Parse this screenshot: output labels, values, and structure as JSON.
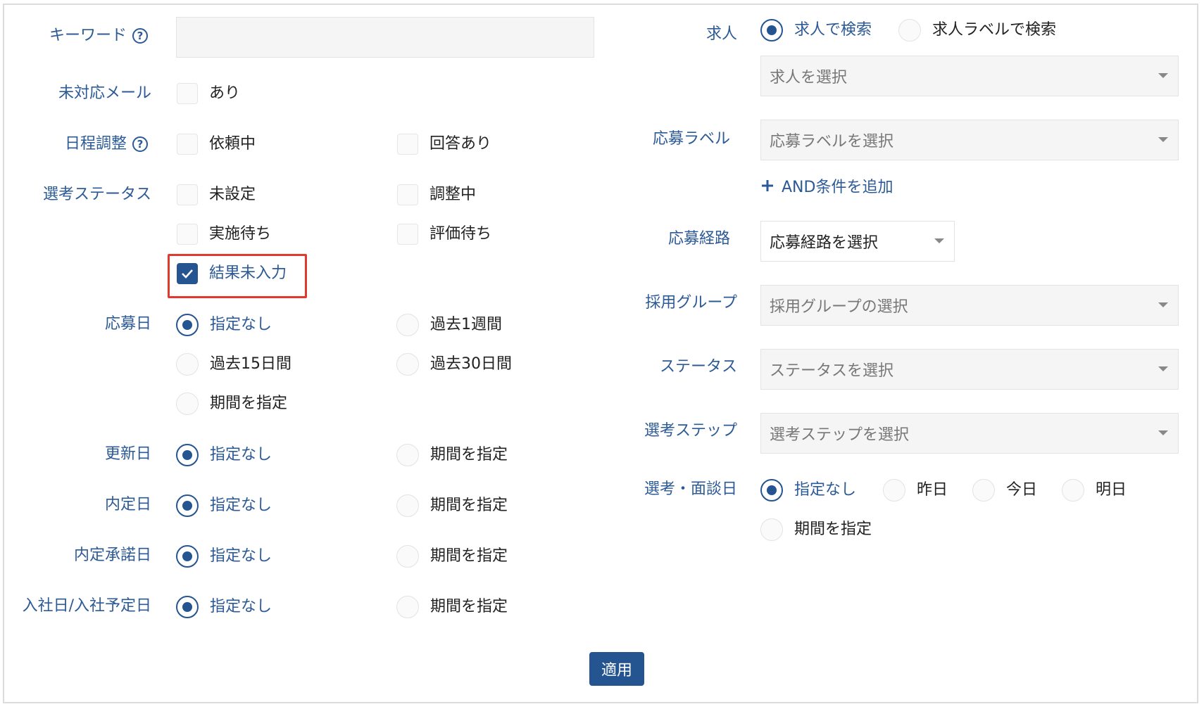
{
  "left": {
    "keyword_label": "キーワード",
    "keyword_value": "",
    "unhandled_mail": {
      "label": "未対応メール",
      "option": "あり"
    },
    "schedule": {
      "label": "日程調整",
      "options": [
        "依頼中",
        "回答あり"
      ]
    },
    "selection_status": {
      "label": "選考ステータス",
      "options": [
        "未設定",
        "調整中",
        "実施待ち",
        "評価待ち",
        "結果未入力"
      ],
      "checked": "結果未入力"
    },
    "applied_date": {
      "label": "応募日",
      "options": [
        "指定なし",
        "過去1週間",
        "過去15日間",
        "過去30日間",
        "期間を指定"
      ],
      "selected": "指定なし"
    },
    "updated_date": {
      "label": "更新日",
      "options": [
        "指定なし",
        "期間を指定"
      ],
      "selected": "指定なし"
    },
    "offer_date": {
      "label": "内定日",
      "options": [
        "指定なし",
        "期間を指定"
      ],
      "selected": "指定なし"
    },
    "offer_accept_date": {
      "label": "内定承諾日",
      "options": [
        "指定なし",
        "期間を指定"
      ],
      "selected": "指定なし"
    },
    "join_date": {
      "label": "入社日/入社予定日",
      "options": [
        "指定なし",
        "期間を指定"
      ],
      "selected": "指定なし"
    }
  },
  "right": {
    "job": {
      "label": "求人",
      "options": [
        "求人で検索",
        "求人ラベルで検索"
      ],
      "selected": "求人で検索",
      "placeholder": "求人を選択"
    },
    "apply_label": {
      "label": "応募ラベル",
      "placeholder": "応募ラベルを選択",
      "add_link": "AND条件を追加",
      "add_icon": "plus-icon"
    },
    "apply_route": {
      "label": "応募経路",
      "value": "応募経路を選択"
    },
    "hiring_group": {
      "label": "採用グループ",
      "placeholder": "採用グループの選択"
    },
    "status": {
      "label": "ステータス",
      "placeholder": "ステータスを選択"
    },
    "selection_step": {
      "label": "選考ステップ",
      "placeholder": "選考ステップを選択"
    },
    "interview_date": {
      "label": "選考・面談日",
      "options": [
        "指定なし",
        "昨日",
        "今日",
        "明日",
        "期間を指定"
      ],
      "selected": "指定なし"
    }
  },
  "apply_button": "適用",
  "colors": {
    "accent": "#245591",
    "label": "#2c5a96",
    "highlight": "#e03a2e"
  }
}
